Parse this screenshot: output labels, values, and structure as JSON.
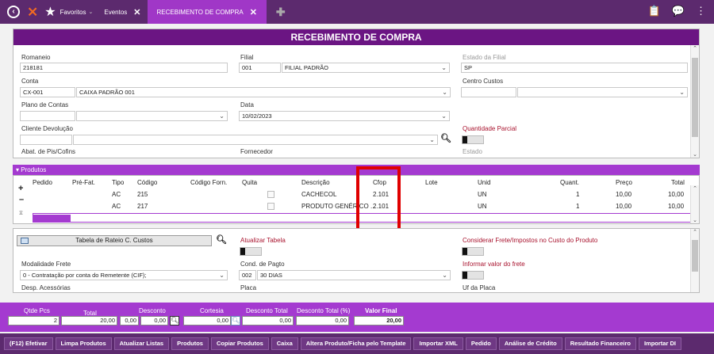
{
  "topbar": {
    "favoritos": "Favoritos",
    "eventos": "Eventos",
    "active_tab": "RECEBIMENTO DE COMPRA",
    "close": "✕",
    "plus": "✚"
  },
  "form": {
    "title": "RECEBIMENTO DE COMPRA",
    "romaneio_label": "Romaneio",
    "romaneio_value": "218181",
    "filial_label": "Filial",
    "filial_code": "001",
    "filial_name": "FILIAL PADRÃO",
    "estado_filial_label": "Estado da Filial",
    "estado_filial_value": "SP",
    "conta_label": "Conta",
    "conta_code": "CX-001",
    "conta_name": "CAIXA PADRÃO 001",
    "centro_custos_label": "Centro Custos",
    "plano_contas_label": "Plano de Contas",
    "data_label": "Data",
    "data_value": "10/02/2023",
    "cliente_devolucao_label": "Cliente Devolução",
    "quantidade_parcial_label": "Quantidade Parcial",
    "abat_label": "Abat. de Pis/Cofins",
    "fornecedor_label": "Fornecedor",
    "estado_label": "Estado"
  },
  "produtos": {
    "header": "Produtos",
    "columns": [
      "Pedido",
      "Pré-Fat.",
      "Tipo",
      "Código",
      "Código Forn.",
      "Quita",
      "Descrição",
      "Cfop",
      "Lote",
      "Unid",
      "Quant.",
      "Preço",
      "Total"
    ],
    "rows": [
      {
        "tipo": "AC",
        "codigo": "215",
        "descricao": "CACHECOL",
        "cfop": "2.101",
        "unid": "UN",
        "quant": "1",
        "preco": "10,00",
        "total": "10,00"
      },
      {
        "tipo": "AC",
        "codigo": "217",
        "descricao": "PRODUTO GENÉRICO ...",
        "cfop": "2.101",
        "unid": "UN",
        "quant": "1",
        "preco": "10,00",
        "total": "10,00"
      }
    ]
  },
  "bottom_form": {
    "rateio_button": "Tabela de Rateio C. Custos",
    "atualizar_tabela_label": "Atualizar Tabela",
    "considerar_frete_label": "Considerar Frete/Impostos no Custo do Produto",
    "modalidade_frete_label": "Modalidade Frete",
    "modalidade_frete_value": "0 - Contratação por conta do Remetente (CIF);",
    "cond_pagto_label": "Cond. de Pagto",
    "cond_pagto_code": "002",
    "cond_pagto_name": "30 DIAS",
    "informar_frete_label": "Informar valor do frete",
    "desp_acessorias_label": "Desp. Acessórias",
    "placa_label": "Placa",
    "uf_placa_label": "Uf da Placa"
  },
  "totals": {
    "qtde_pcs_label": "Qtde Pcs",
    "qtde_pcs_value": "2",
    "total_label": "Total",
    "total_value": "20,00",
    "desconto_label": "Desconto",
    "desconto_value1": "0,00",
    "desconto_value2": "0,00",
    "cortesia_label": "Cortesia",
    "cortesia_value": "0,00",
    "desconto_total_label": "Desconto Total",
    "desconto_total_value": "0,00",
    "desconto_total_pct_label": "Desconto Total (%)",
    "desconto_total_pct_value": "0,00",
    "valor_final_label": "Valor Final",
    "valor_final_value": "20,00"
  },
  "buttons": [
    "(F12) Efetivar",
    "Limpa Produtos",
    "Atualizar Listas",
    "Produtos",
    "Copiar Produtos",
    "Caixa",
    "Altera Produto/Ficha pelo Template",
    "Importar XML",
    "Pedido",
    "Análise de Crédito",
    "Resultado Financeiro",
    "Importar DI"
  ],
  "colors": {
    "brand_dark": "#5c2a6e",
    "brand": "#a43ad0",
    "title": "#6b1583",
    "highlight": "#e00000"
  }
}
